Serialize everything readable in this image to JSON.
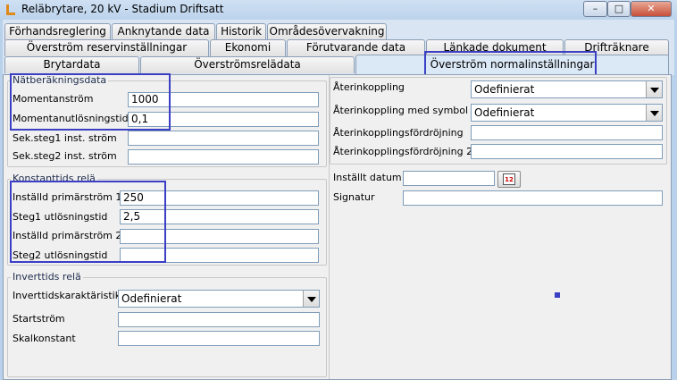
{
  "window": {
    "title": "Relä­brytare, 20 kV - Stadium Driftsatt",
    "minimize_glyph": "–",
    "maximize_glyph": "□",
    "close_glyph": "✕"
  },
  "tabs": {
    "row1": [
      "Förhandsreglering",
      "Anknytande data",
      "Historik",
      "Områdesövervakning"
    ],
    "row2": [
      "Överström reservinställningar",
      "Ekonomi",
      "Förutvarande data",
      "Länkade dokument",
      "Drifträknare"
    ],
    "row3": [
      "Brytardata",
      "Överströmsrelädata",
      "Överström normalinställningar"
    ],
    "active": "Överström normalinställningar"
  },
  "natberakning": {
    "legend": "Nätberäkningsdata",
    "momentanstrom_label": "Momentanström",
    "momentanstrom_value": "1000",
    "momentanutlosningstid_label": "Momentanutlösningstid",
    "momentanutlosningstid_value": "0,1",
    "sek1_label": "Sek.steg1 inst. ström",
    "sek1_value": "",
    "sek2_label": "Sek.steg2 inst. ström",
    "sek2_value": ""
  },
  "konstanttid": {
    "legend": "Konstanttids relä",
    "prim1_label": "Inställd primärström 1",
    "prim1_value": "250",
    "steg1_label": "Steg1 utlösningstid",
    "steg1_value": "2,5",
    "prim2_label": "Inställd primärström 2",
    "prim2_value": "",
    "steg2_label": "Steg2 utlösningstid",
    "steg2_value": ""
  },
  "inverttid": {
    "legend": "Inverttids relä",
    "karakteristik_label": "Inverttidskaraktäristik",
    "karakteristik_value": "Odefinierat",
    "startstrom_label": "Startström",
    "startstrom_value": "",
    "skalkonstant_label": "Skalkonstant",
    "skalkonstant_value": ""
  },
  "aterkoppling": {
    "aterkoppling_label": "Återinkoppling",
    "aterkoppling_value": "Odefinierat",
    "symbol_label": "Återinkoppling med symbol",
    "symbol_value": "Odefinierat",
    "fordrojning_label": "Återinkopplingsfördröjning",
    "fordrojning_value": "",
    "fordrojning2_label": "Återinkopplingsfördröjning 2",
    "fordrojning2_value": ""
  },
  "signering": {
    "datum_label": "Inställt datum",
    "datum_value": "",
    "calendar_icon": "calendar-icon",
    "calendar_text": "12",
    "signatur_label": "Signatur",
    "signatur_value": ""
  },
  "colors": {
    "highlight": "#3a3fc4",
    "window_bg": "#b9d1ea",
    "panel_bg": "#f0f0f0"
  }
}
